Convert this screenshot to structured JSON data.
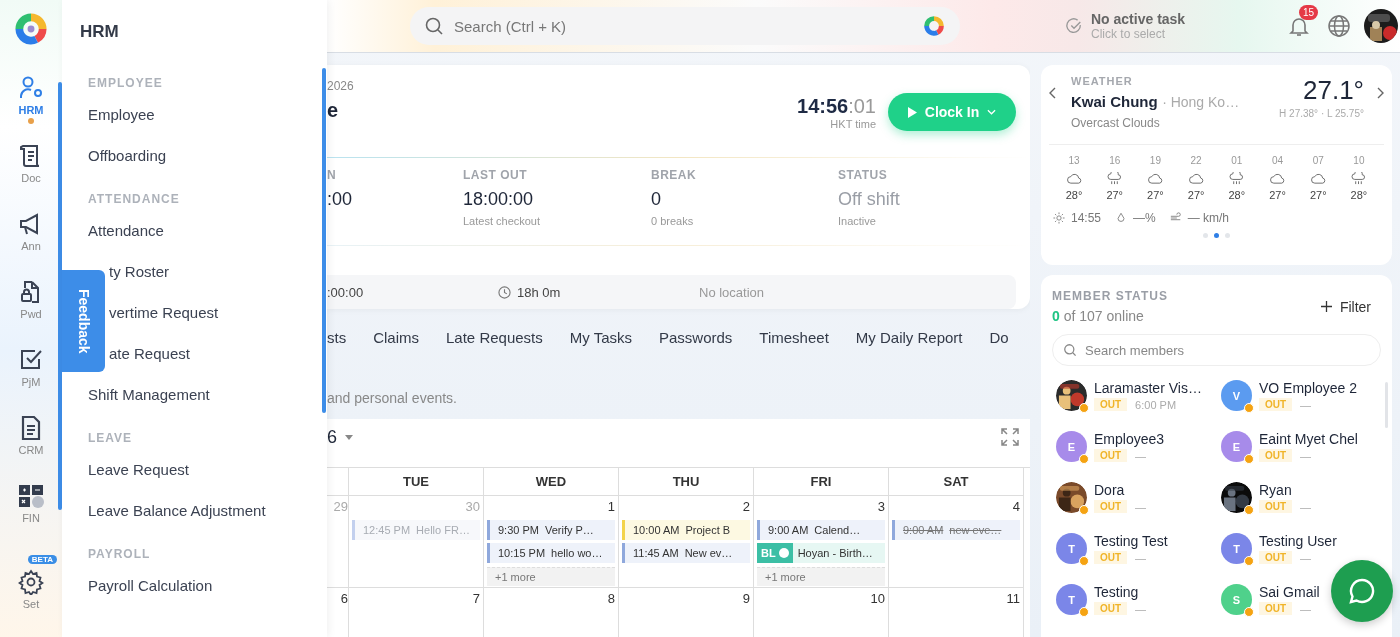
{
  "rail": {
    "items": [
      {
        "label": "HRM",
        "selected": true
      },
      {
        "label": "Doc",
        "selected": false
      },
      {
        "label": "Ann",
        "selected": false
      },
      {
        "label": "Pwd",
        "selected": false
      },
      {
        "label": "PjM",
        "selected": false
      },
      {
        "label": "CRM",
        "selected": false
      },
      {
        "label": "FIN",
        "selected": false
      },
      {
        "label": "Set",
        "selected": false,
        "badge": "BETA"
      }
    ]
  },
  "menu": {
    "title": "HRM",
    "sections": [
      {
        "heading": "EMPLOYEE",
        "items": [
          {
            "label": "Employee"
          },
          {
            "label": "Offboarding"
          }
        ]
      },
      {
        "heading": "ATTENDANCE",
        "items": [
          {
            "label": "Attendance"
          },
          {
            "label": "ty Roster",
            "covered": true
          },
          {
            "label": "vertime Request",
            "covered": true
          },
          {
            "label": "ate Request",
            "covered": true
          },
          {
            "label": "Shift Management"
          }
        ]
      },
      {
        "heading": "LEAVE",
        "items": [
          {
            "label": "Leave Request"
          },
          {
            "label": "Leave Balance Adjustment"
          }
        ]
      },
      {
        "heading": "PAYROLL",
        "items": [
          {
            "label": "Payroll Calculation"
          }
        ]
      }
    ]
  },
  "feedback": "Feedback",
  "search": {
    "placeholder": "Search (Ctrl + K)"
  },
  "task": {
    "title": "No active task",
    "hint": "Click to select"
  },
  "notifications": {
    "count": "15"
  },
  "clock_card": {
    "date": "2026",
    "title": "e",
    "time": "14:56",
    "seconds": ":01",
    "zone": "HKT time",
    "button": "Clock In",
    "stats": [
      {
        "label": "N",
        "value": ":00",
        "muted": false
      },
      {
        "label": "LAST OUT",
        "value": "18:00:00",
        "note": "Latest checkout",
        "muted": false
      },
      {
        "label": "BREAK",
        "value": "0",
        "note": "0 breaks",
        "muted": false
      },
      {
        "label": "STATUS",
        "value": "Off shift",
        "note": "Inactive",
        "muted": true
      }
    ],
    "shift": {
      "time": ":00:00",
      "duration": "18h 0m",
      "location": "No location"
    }
  },
  "tabs": [
    "sts",
    "Claims",
    "Late Requests",
    "My Tasks",
    "Passwords",
    "Timesheet",
    "My Daily Report",
    "Do"
  ],
  "calendar": {
    "description": "and personal events.",
    "month": "6",
    "days": [
      "TUE",
      "WED",
      "THU",
      "FRI",
      "SAT"
    ],
    "weeks": [
      {
        "days": [
          {
            "date": "29",
            "muted": true
          },
          {
            "date": "30",
            "muted": true,
            "events": [
              {
                "kind": "event",
                "time": "12:45 PM",
                "title": "Hello FR…",
                "color": "#c3d0ee",
                "faded": true,
                "done": false
              }
            ]
          },
          {
            "date": "1",
            "muted": false,
            "events": [
              {
                "kind": "event",
                "time": "9:30 PM",
                "title": "Verify P…",
                "color": "#8fa8dc",
                "faded": false,
                "done": false
              },
              {
                "kind": "event",
                "time": "10:15 PM",
                "title": "hello wo…",
                "color": "#8fa8dc",
                "faded": false,
                "done": false
              }
            ],
            "more": "+1 more"
          },
          {
            "date": "2",
            "muted": false,
            "events": [
              {
                "kind": "event",
                "time": "10:00 AM",
                "title": "Project B",
                "color": "#f3d34a",
                "faded": false,
                "done": false
              },
              {
                "kind": "event",
                "time": "11:45 AM",
                "title": "New ev…",
                "color": "#8fa8dc",
                "faded": false,
                "done": false
              }
            ]
          },
          {
            "date": "3",
            "muted": false,
            "events": [
              {
                "kind": "event",
                "time": "9:00 AM",
                "title": "Calend…",
                "color": "#8fa8dc",
                "faded": false,
                "done": false
              },
              {
                "kind": "birthday",
                "badge": "BL",
                "title": "Hoyan - Birth…",
                "color": "#3cbfa5"
              }
            ],
            "more": "+1 more"
          },
          {
            "date": "4",
            "muted": false,
            "events": [
              {
                "kind": "event",
                "time": "9:00 AM",
                "title": "new eve…",
                "color": "#8fa8dc",
                "faded": false,
                "done": true
              }
            ]
          }
        ]
      },
      {
        "days": [
          {
            "date": "6",
            "muted": false
          },
          {
            "date": "7",
            "muted": false
          },
          {
            "date": "8",
            "muted": false
          },
          {
            "date": "9",
            "muted": false
          },
          {
            "date": "10",
            "muted": false
          },
          {
            "date": "11",
            "muted": false
          }
        ]
      }
    ]
  },
  "weather": {
    "label": "WEATHER",
    "city": "Kwai Chung",
    "region": "· Hong Ko…",
    "condition": "Overcast Clouds",
    "temp": "27.1°",
    "range": "H 27.38° · L 25.75°",
    "hours": [
      {
        "hour": "13",
        "kind": "cloud",
        "temp": "28°"
      },
      {
        "hour": "16",
        "kind": "rain",
        "temp": "27°"
      },
      {
        "hour": "19",
        "kind": "cloud",
        "temp": "27°"
      },
      {
        "hour": "22",
        "kind": "cloud",
        "temp": "27°"
      },
      {
        "hour": "01",
        "kind": "rain",
        "temp": "28°"
      },
      {
        "hour": "04",
        "kind": "cloud",
        "temp": "27°"
      },
      {
        "hour": "07",
        "kind": "cloud",
        "temp": "27°"
      },
      {
        "hour": "10",
        "kind": "rain",
        "temp": "28°"
      }
    ],
    "time": "14:55",
    "humidity": "—%",
    "wind": "— km/h",
    "pages": [
      {
        "selected": false
      },
      {
        "selected": true
      },
      {
        "selected": false
      }
    ]
  },
  "members": {
    "title": "MEMBER STATUS",
    "online_count": "0",
    "online_text": "of 107 online",
    "filter": "Filter",
    "search_placeholder": "Search members",
    "list": [
      {
        "name": "Laramaster Vis…",
        "kind": "picture",
        "status": "OUT",
        "time": "6:00 PM"
      },
      {
        "name": "VO Employee 2",
        "kind": "initial",
        "initial": "V",
        "color": "#5b9bf0",
        "status": "OUT",
        "time": "—"
      },
      {
        "name": "Employee3",
        "kind": "initial",
        "initial": "E",
        "color": "#a78bea",
        "status": "OUT",
        "time": "—"
      },
      {
        "name": "Eaint Myet Chel",
        "kind": "initial",
        "initial": "E",
        "color": "#a78bea",
        "status": "OUT",
        "time": "—"
      },
      {
        "name": "Dora",
        "kind": "picture",
        "status": "OUT",
        "time": "—"
      },
      {
        "name": "Ryan",
        "kind": "picture",
        "status": "OUT",
        "time": "—"
      },
      {
        "name": "Testing Test",
        "kind": "initial",
        "initial": "T",
        "color": "#7b86e8",
        "status": "OUT",
        "time": "—"
      },
      {
        "name": "Testing User",
        "kind": "initial",
        "initial": "T",
        "color": "#7b86e8",
        "status": "OUT",
        "time": "—"
      },
      {
        "name": "Testing",
        "kind": "initial",
        "initial": "T",
        "color": "#7b86e8",
        "status": "OUT",
        "time": "—"
      },
      {
        "name": "Sai Gmail",
        "kind": "initial",
        "initial": "S",
        "color": "#4fd18b",
        "status": "OUT",
        "time": "—"
      }
    ]
  }
}
